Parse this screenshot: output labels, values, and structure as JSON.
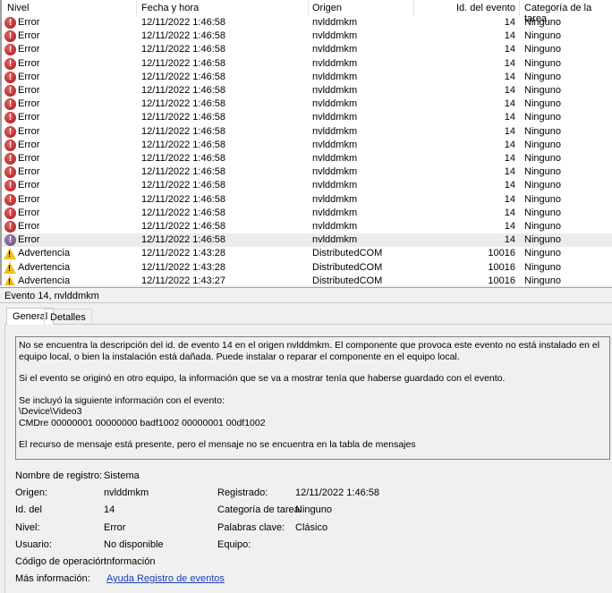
{
  "columns": [
    "Nivel",
    "Fecha y hora",
    "Origen",
    "Id. del evento",
    "Categoría de la tarea"
  ],
  "rows": [
    {
      "level": "Error",
      "icon": "error-icon",
      "date": "12/11/2022 1:46:58",
      "source": "nvlddmkm",
      "id": "14",
      "category": "Ninguno"
    },
    {
      "level": "Error",
      "icon": "error-icon",
      "date": "12/11/2022 1:46:58",
      "source": "nvlddmkm",
      "id": "14",
      "category": "Ninguno"
    },
    {
      "level": "Error",
      "icon": "error-icon",
      "date": "12/11/2022 1:46:58",
      "source": "nvlddmkm",
      "id": "14",
      "category": "Ninguno"
    },
    {
      "level": "Error",
      "icon": "error-icon",
      "date": "12/11/2022 1:46:58",
      "source": "nvlddmkm",
      "id": "14",
      "category": "Ninguno"
    },
    {
      "level": "Error",
      "icon": "error-icon",
      "date": "12/11/2022 1:46:58",
      "source": "nvlddmkm",
      "id": "14",
      "category": "Ninguno"
    },
    {
      "level": "Error",
      "icon": "error-icon",
      "date": "12/11/2022 1:46:58",
      "source": "nvlddmkm",
      "id": "14",
      "category": "Ninguno"
    },
    {
      "level": "Error",
      "icon": "error-icon",
      "date": "12/11/2022 1:46:58",
      "source": "nvlddmkm",
      "id": "14",
      "category": "Ninguno"
    },
    {
      "level": "Error",
      "icon": "error-icon",
      "date": "12/11/2022 1:46:58",
      "source": "nvlddmkm",
      "id": "14",
      "category": "Ninguno"
    },
    {
      "level": "Error",
      "icon": "error-icon",
      "date": "12/11/2022 1:46:58",
      "source": "nvlddmkm",
      "id": "14",
      "category": "Ninguno"
    },
    {
      "level": "Error",
      "icon": "error-icon",
      "date": "12/11/2022 1:46:58",
      "source": "nvlddmkm",
      "id": "14",
      "category": "Ninguno"
    },
    {
      "level": "Error",
      "icon": "error-icon",
      "date": "12/11/2022 1:46:58",
      "source": "nvlddmkm",
      "id": "14",
      "category": "Ninguno"
    },
    {
      "level": "Error",
      "icon": "error-icon",
      "date": "12/11/2022 1:46:58",
      "source": "nvlddmkm",
      "id": "14",
      "category": "Ninguno"
    },
    {
      "level": "Error",
      "icon": "error-icon",
      "date": "12/11/2022 1:46:58",
      "source": "nvlddmkm",
      "id": "14",
      "category": "Ninguno"
    },
    {
      "level": "Error",
      "icon": "error-icon",
      "date": "12/11/2022 1:46:58",
      "source": "nvlddmkm",
      "id": "14",
      "category": "Ninguno"
    },
    {
      "level": "Error",
      "icon": "error-icon",
      "date": "12/11/2022 1:46:58",
      "source": "nvlddmkm",
      "id": "14",
      "category": "Ninguno"
    },
    {
      "level": "Error",
      "icon": "error-icon",
      "date": "12/11/2022 1:46:58",
      "source": "nvlddmkm",
      "id": "14",
      "category": "Ninguno"
    },
    {
      "level": "Error",
      "icon": "error-icon",
      "date": "12/11/2022 1:46:58",
      "source": "nvlddmkm",
      "id": "14",
      "category": "Ninguno",
      "selected": true
    },
    {
      "level": "Advertencia",
      "icon": "warning-icon",
      "date": "12/11/2022 1:43:28",
      "source": "DistributedCOM",
      "id": "10016",
      "category": "Ninguno"
    },
    {
      "level": "Advertencia",
      "icon": "warning-icon",
      "date": "12/11/2022 1:43:28",
      "source": "DistributedCOM",
      "id": "10016",
      "category": "Ninguno"
    },
    {
      "level": "Advertencia",
      "icon": "warning-icon",
      "date": "12/11/2022 1:43:27",
      "source": "DistributedCOM",
      "id": "10016",
      "category": "Ninguno"
    }
  ],
  "detail": {
    "title": "Evento 14, nvlddmkm",
    "tabs": [
      "General",
      "Detalles"
    ],
    "description": [
      "No se encuentra la descripción del id. de evento 14 en el origen nvlddmkm. El componente que provoca este evento no está instalado en el equipo local, o bien la instalación está dañada. Puede instalar o reparar el componente en el equipo local.",
      "Si el evento se originó en otro equipo, la información que se va a mostrar tenía que haberse guardado con el evento.",
      "Se incluyó la siguiente información con el evento:\n\\Device\\Video3\nCMDre 00000001 00000000 badf1002 00000001 00df1002",
      "El recurso de mensaje está presente, pero el mensaje no se encuentra en la tabla de mensajes"
    ],
    "fields": {
      "log_name_label": "Nombre de registro:",
      "log_name": "Sistema",
      "source_label": "Origen:",
      "source": "nvlddmkm",
      "logged_label": "Registrado:",
      "logged": "12/11/2022 1:46:58",
      "id_label": "Id. del",
      "id": "14",
      "task_label": "Categoría de tarea:",
      "task": "Ninguno",
      "level_label": "Nivel:",
      "level": "Error",
      "keywords_label": "Palabras clave:",
      "keywords": "Clásico",
      "user_label": "Usuario:",
      "user": "No disponible",
      "computer_label": "Equipo:",
      "opcode_label": "Código de operación:",
      "opcode": "Información",
      "more_label": "Más información:",
      "more_link": "Ayuda Registro de eventos"
    }
  }
}
